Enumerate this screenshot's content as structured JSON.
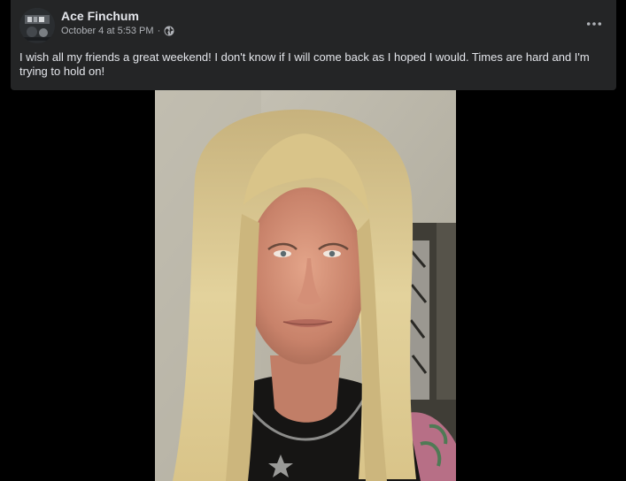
{
  "post": {
    "author_name": "Ace Finchum",
    "timestamp": "October 4 at 5:53 PM",
    "separator": "·",
    "audience_icon": "globe-icon",
    "more_icon": "more-options-icon",
    "text": "I wish all my friends a great weekend! I don't know if I will come back as I hoped I would. Times are hard and I'm trying to hold on!",
    "photo_subject": "selfie-photo"
  },
  "colors": {
    "background": "#000000",
    "card": "#242526",
    "primary_text": "#e4e6eb",
    "secondary_text": "#b0b3b8"
  }
}
